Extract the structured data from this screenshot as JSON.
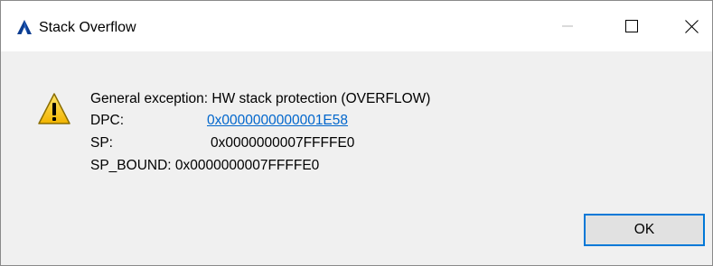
{
  "window": {
    "title": "Stack Overflow",
    "app_icon": "autodesk-a-icon",
    "controls": {
      "minimize_icon": "minimize-icon",
      "maximize_icon": "maximize-icon",
      "close_icon": "close-icon"
    }
  },
  "dialog": {
    "icon": "warning-icon",
    "message": "General exception: HW stack protection (OVERFLOW)",
    "dpc_label": "DPC:",
    "dpc_value": "0x0000000000001E58",
    "sp_label": "SP:",
    "sp_value": "0x0000000007FFFFE0",
    "sp_bound": "SP_BOUND: 0x0000000007FFFFE0",
    "ok_label": "OK"
  },
  "colors": {
    "link": "#0066cc",
    "accent": "#0078d7",
    "warning": "#f5c518"
  }
}
